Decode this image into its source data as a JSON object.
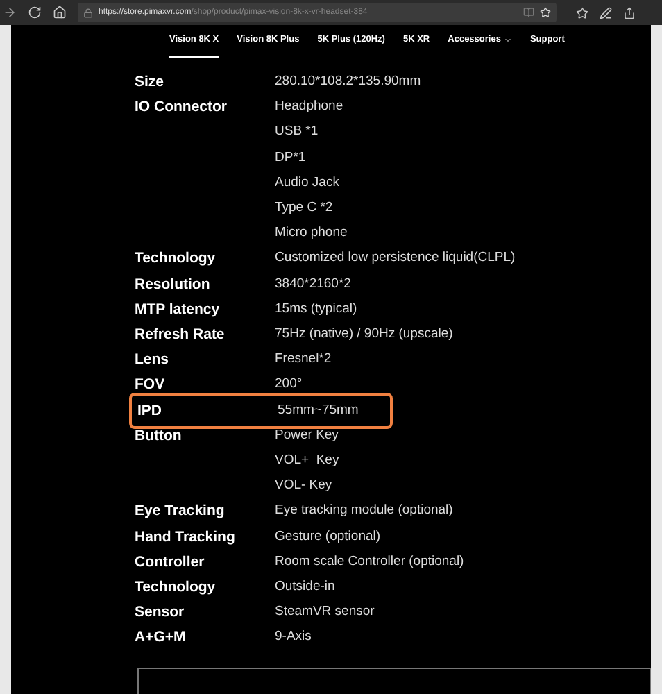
{
  "browser": {
    "url_host": "https://store.pimaxvr.com",
    "url_path": "/shop/product/pimax-vision-8k-x-vr-headset-384"
  },
  "nav": [
    {
      "label": "Vision 8K X",
      "selected": true,
      "dropdown": false
    },
    {
      "label": "Vision 8K Plus",
      "selected": false,
      "dropdown": false
    },
    {
      "label": "5K Plus (120Hz)",
      "selected": false,
      "dropdown": false
    },
    {
      "label": "5K XR",
      "selected": false,
      "dropdown": false
    },
    {
      "label": "Accessories",
      "selected": false,
      "dropdown": true
    },
    {
      "label": "Support",
      "selected": false,
      "dropdown": false
    }
  ],
  "specs": [
    {
      "label": "Size",
      "values": [
        "280.10*108.2*135.90mm"
      ],
      "highlighted": false
    },
    {
      "label": "IO Connector",
      "values": [
        "Headphone",
        "USB *1",
        "DP*1",
        "Audio Jack",
        "Type C *2",
        "Micro phone"
      ],
      "highlighted": false
    },
    {
      "label": "Technology",
      "values": [
        "Customized low persistence liquid(CLPL)"
      ],
      "highlighted": false
    },
    {
      "label": "Resolution",
      "values": [
        "3840*2160*2"
      ],
      "highlighted": false
    },
    {
      "label": "MTP latency",
      "values": [
        "15ms (typical)"
      ],
      "highlighted": false
    },
    {
      "label": "Refresh Rate",
      "values": [
        "75Hz (native) / 90Hz (upscale)"
      ],
      "highlighted": false
    },
    {
      "label": "Lens",
      "values": [
        "Fresnel*2"
      ],
      "highlighted": false
    },
    {
      "label": "FOV",
      "values": [
        "200°"
      ],
      "highlighted": false
    },
    {
      "label": "IPD",
      "values": [
        "55mm~75mm"
      ],
      "highlighted": true
    },
    {
      "label": "Button",
      "values": [
        "Power Key",
        "VOL+  Key",
        "VOL- Key"
      ],
      "highlighted": false
    },
    {
      "label": "Eye Tracking",
      "values": [
        "Eye tracking module (optional)"
      ],
      "highlighted": false
    },
    {
      "label": "Hand Tracking",
      "values": [
        "Gesture (optional)"
      ],
      "highlighted": false
    },
    {
      "label": "Controller",
      "values": [
        "Room scale Controller (optional)"
      ],
      "highlighted": false
    },
    {
      "label": "Technology",
      "values": [
        "Outside-in"
      ],
      "highlighted": false
    },
    {
      "label": "Sensor",
      "values": [
        "SteamVR sensor"
      ],
      "highlighted": false
    },
    {
      "label": "A+G+M",
      "values": [
        "9-Axis"
      ],
      "highlighted": false
    }
  ]
}
